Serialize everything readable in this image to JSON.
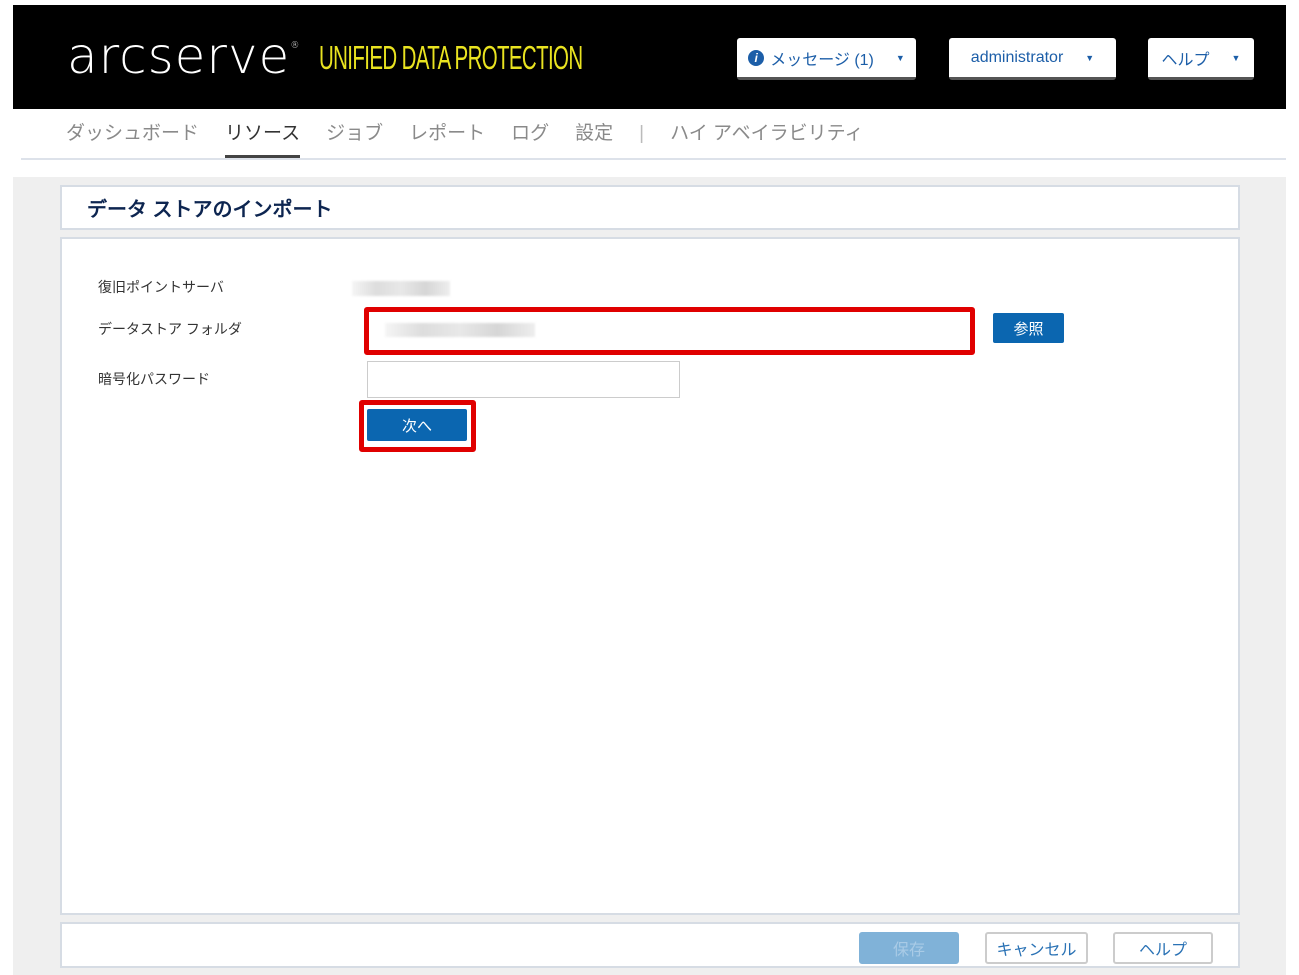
{
  "header": {
    "logo": "arcserve",
    "product": "UNIFIED DATA PROTECTION",
    "messages_label": "メッセージ (1)",
    "user_label": "administrator",
    "help_label": "ヘルプ"
  },
  "nav": {
    "items": [
      "ダッシュボード",
      "リソース",
      "ジョブ",
      "レポート",
      "ログ",
      "設定"
    ],
    "separator": "|",
    "ha": "ハイ アベイラビリティ",
    "active": "リソース"
  },
  "page": {
    "title": "データ ストアのインポート"
  },
  "form": {
    "rps_label": "復旧ポイントサーバ",
    "folder_label": "データストア フォルダ",
    "password_label": "暗号化パスワード",
    "password_value": "",
    "browse_label": "参照",
    "next_label": "次へ"
  },
  "footer": {
    "save": "保存",
    "cancel": "キャンセル",
    "help": "ヘルプ"
  },
  "colors": {
    "accent": "#0b66b0",
    "highlight": "#e00000",
    "product": "#e9e320"
  }
}
